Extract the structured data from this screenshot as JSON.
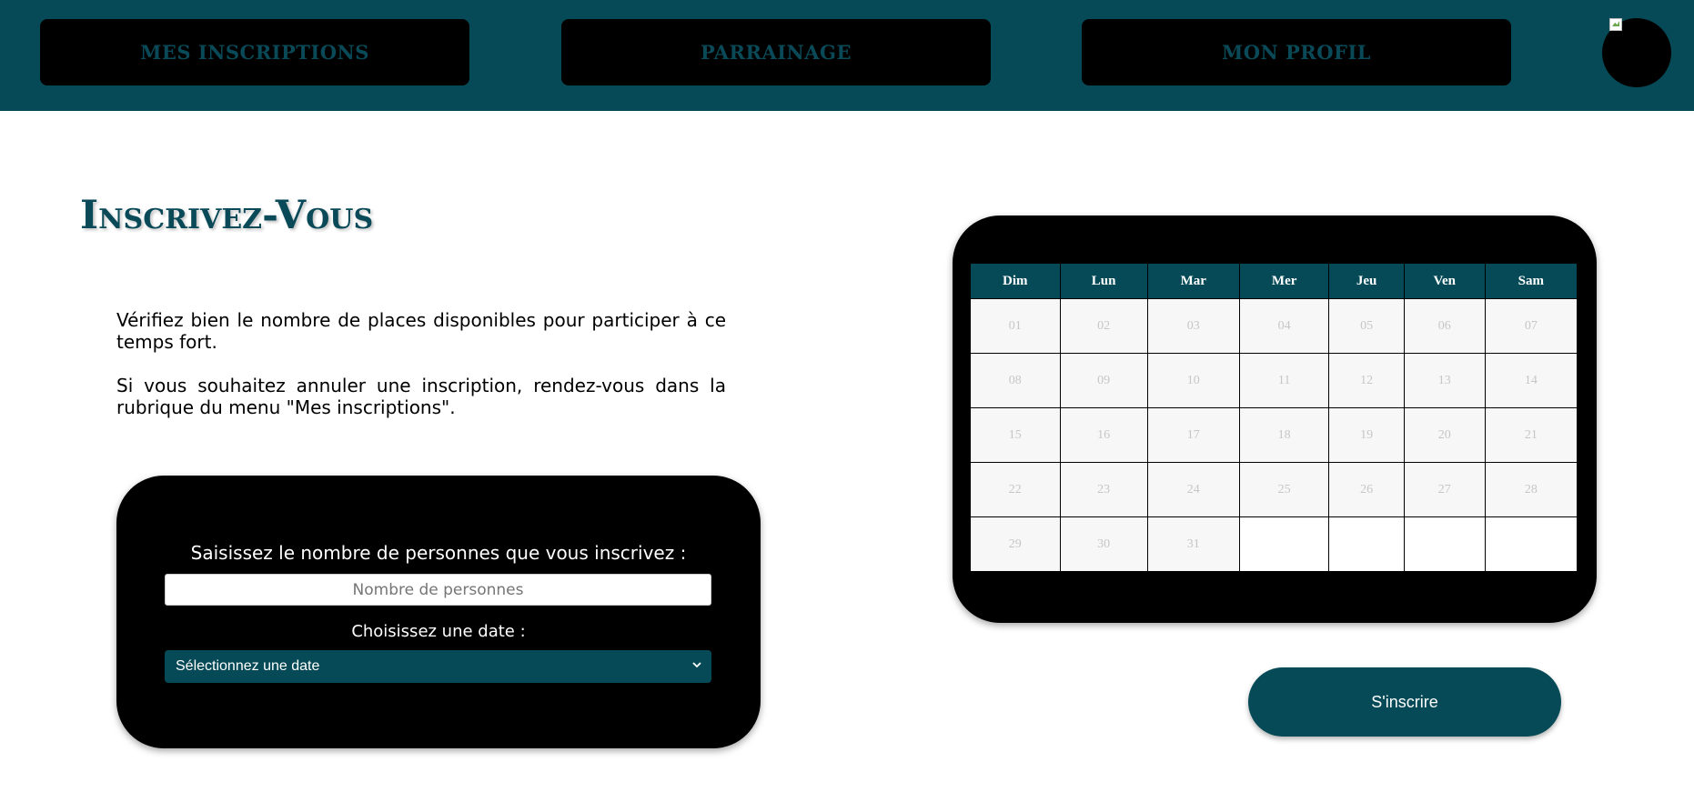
{
  "nav": {
    "items": [
      {
        "label": "MES INSCRIPTIONS"
      },
      {
        "label": "PARRAINAGE"
      },
      {
        "label": "MON PROFIL"
      }
    ]
  },
  "page": {
    "title": "Inscrivez-Vous",
    "intro_1": "Vérifiez bien le nombre de places disponibles pour participer à ce temps fort.",
    "intro_2": "Si vous souhaitez annuler une inscription, rendez-vous dans la rubrique du menu \"Mes inscriptions\"."
  },
  "form": {
    "people_label": "Saisissez le nombre de personnes que vous inscrivez :",
    "people_placeholder": "Nombre de personnes",
    "date_label": "Choisissez une date :",
    "date_selected": "Sélectionnez une date"
  },
  "calendar": {
    "weekdays": [
      "Dim",
      "Lun",
      "Mar",
      "Mer",
      "Jeu",
      "Ven",
      "Sam"
    ],
    "weeks": [
      [
        "01",
        "02",
        "03",
        "04",
        "05",
        "06",
        "07"
      ],
      [
        "08",
        "09",
        "10",
        "11",
        "12",
        "13",
        "14"
      ],
      [
        "15",
        "16",
        "17",
        "18",
        "19",
        "20",
        "21"
      ],
      [
        "22",
        "23",
        "24",
        "25",
        "26",
        "27",
        "28"
      ],
      [
        "29",
        "30",
        "31",
        "",
        "",
        "",
        ""
      ]
    ]
  },
  "submit": {
    "label": "S'inscrire"
  },
  "colors": {
    "primary": "#054a56",
    "card": "#000000",
    "nav_text": "#0a4a58"
  }
}
